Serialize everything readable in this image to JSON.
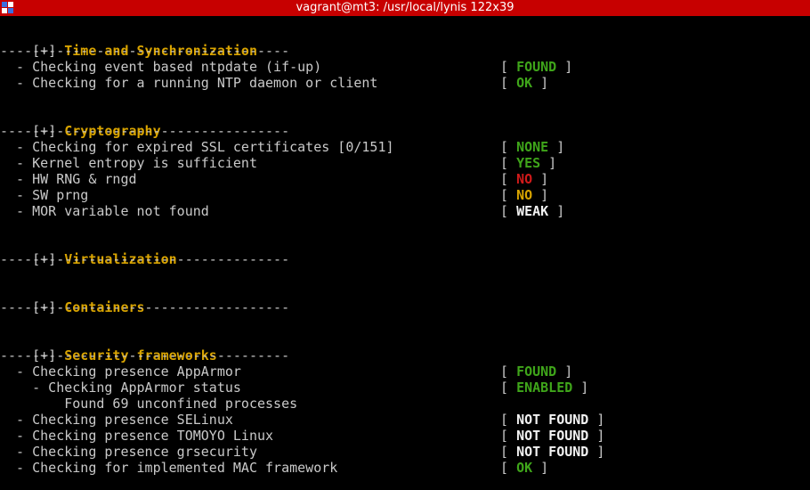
{
  "window": {
    "title": "vagrant@mt3: /usr/local/lynis 122x39"
  },
  "colors": {
    "titlebar": "#c70000",
    "section": "#d9a400",
    "ok": "#3fa51a",
    "bad": "#d11a1a",
    "warn": "#d9a400",
    "neutral": "#f2f2f2"
  },
  "divider": "------------------------------------",
  "sections": {
    "time": {
      "marker": "[+]",
      "title": "Time and Synchronization",
      "items": [
        {
          "text": "  - Checking event based ntpdate (if-up)",
          "status": "FOUND"
        },
        {
          "text": "  - Checking for a running NTP daemon or client",
          "status": "OK"
        }
      ]
    },
    "crypto": {
      "marker": "[+]",
      "title": "Cryptography",
      "items": [
        {
          "text": "  - Checking for expired SSL certificates [0/151]",
          "status": "NONE"
        },
        {
          "text": "  - Kernel entropy is sufficient",
          "status": "YES"
        },
        {
          "text": "  - HW RNG & rngd",
          "status": "NO"
        },
        {
          "text": "  - SW prng",
          "status": "NO"
        },
        {
          "text": "  - MOR variable not found",
          "status": "WEAK"
        }
      ]
    },
    "virt": {
      "marker": "[+]",
      "title": "Virtualization"
    },
    "containers": {
      "marker": "[+]",
      "title": "Containers"
    },
    "security": {
      "marker": "[+]",
      "title": "Security frameworks",
      "items": [
        {
          "text": "  - Checking presence AppArmor",
          "status": "FOUND"
        },
        {
          "text": "    - Checking AppArmor status",
          "status": "ENABLED"
        },
        {
          "text": "        Found 69 unconfined processes"
        },
        {
          "text": "  - Checking presence SELinux",
          "status": "NOT FOUND"
        },
        {
          "text": "  - Checking presence TOMOYO Linux",
          "status": "NOT FOUND"
        },
        {
          "text": "  - Checking presence grsecurity",
          "status": "NOT FOUND"
        },
        {
          "text": "  - Checking for implemented MAC framework",
          "status": "OK"
        }
      ]
    }
  },
  "status_brackets": {
    "open": "[ ",
    "close": " ]"
  }
}
